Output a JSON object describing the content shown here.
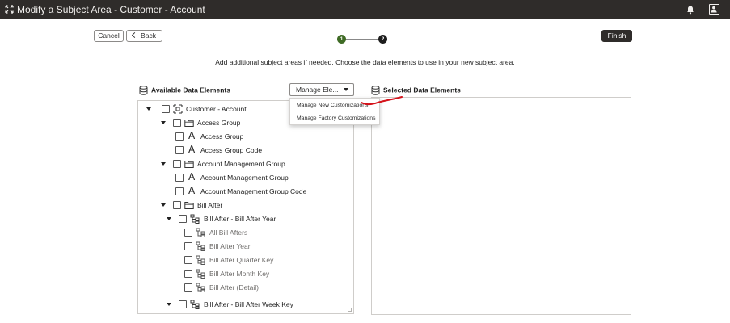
{
  "titlebar": {
    "title": "Modify a Subject Area - Customer - Account",
    "app_icon": "expand-arrows-icon",
    "notification_icon": "bell-icon",
    "user_icon": "user-avatar-icon"
  },
  "toolbar": {
    "cancel_label": "Cancel",
    "back_label": "Back",
    "finish_label": "Finish"
  },
  "stepper": {
    "steps": [
      "1",
      "2"
    ],
    "current_step": 1,
    "completed_color": "#3f6b25",
    "pending_color": "#1d1d1d"
  },
  "instructions": "Add additional subject areas if needed. Choose the data elements to use in your new subject area.",
  "available": {
    "heading": "Available Data Elements",
    "manage_button_label": "Manage Ele...",
    "manage_menu": [
      "Manage New Customizations",
      "Manage Factory Customizations"
    ],
    "tree": [
      {
        "label": "Customer - Account",
        "icon": "subject-area-icon",
        "expanded": true
      },
      {
        "label": "Access Group",
        "icon": "folder-icon",
        "expanded": true
      },
      {
        "label": "Access Group",
        "icon": "text-attribute-icon"
      },
      {
        "label": "Access Group Code",
        "icon": "text-attribute-icon"
      },
      {
        "label": "Account Management Group",
        "icon": "folder-icon",
        "expanded": true
      },
      {
        "label": "Account Management Group",
        "icon": "text-attribute-icon"
      },
      {
        "label": "Account Management Group Code",
        "icon": "text-attribute-icon"
      },
      {
        "label": "Bill After",
        "icon": "folder-icon",
        "expanded": true
      },
      {
        "label": "Bill After - Bill After Year",
        "icon": "hierarchy-icon",
        "expanded": true
      },
      {
        "label": "All Bill Afters",
        "icon": "hierarchy-level-icon"
      },
      {
        "label": "Bill After Year",
        "icon": "hierarchy-level-icon"
      },
      {
        "label": "Bill After Quarter Key",
        "icon": "hierarchy-level-icon"
      },
      {
        "label": "Bill After Month Key",
        "icon": "hierarchy-level-icon"
      },
      {
        "label": "Bill After (Detail)",
        "icon": "hierarchy-level-icon"
      },
      {
        "label": "Bill After - Bill After Week Key",
        "icon": "hierarchy-icon",
        "expanded": true
      }
    ]
  },
  "selected": {
    "heading": "Selected Data Elements"
  },
  "colors": {
    "titlebar_bg": "#2f2c2a",
    "finish_bg": "#2f2c2a",
    "annotation_red": "#d4121a"
  }
}
